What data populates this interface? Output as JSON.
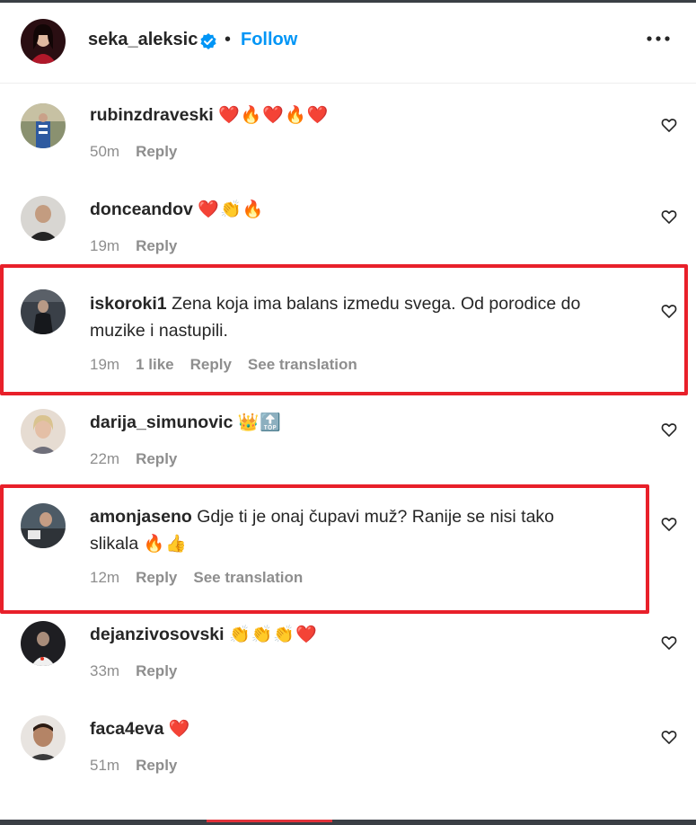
{
  "post": {
    "username": "seka_aleksic",
    "separator": "•",
    "follow_label": "Follow",
    "more_icon": "more-horizontal-icon",
    "verified_icon": "verified-badge-icon"
  },
  "comments": [
    {
      "username": "rubinzdraveski",
      "text": "",
      "emoji": "❤️🔥❤️🔥❤️",
      "time": "50m",
      "likes": "",
      "reply": "Reply",
      "translate": ""
    },
    {
      "username": "donceandov",
      "text": "",
      "emoji": "❤️👏🔥",
      "time": "19m",
      "likes": "",
      "reply": "Reply",
      "translate": ""
    },
    {
      "username": "iskoroki1",
      "text_line1": "Zena koja ima balans izmedu svega. Od porodice do",
      "text_line2": "muzike i nastupili.",
      "time": "19m",
      "likes": "1 like",
      "reply": "Reply",
      "translate": "See translation"
    },
    {
      "username": "darija_simunovic",
      "text": "",
      "emoji": "👑🔝",
      "time": "22m",
      "likes": "",
      "reply": "Reply",
      "translate": ""
    },
    {
      "username": "amonjaseno",
      "text_line1": "Gdje ti je onaj čupavi muž? Ranije se nisi tako",
      "text_line2": "slikala",
      "emoji": "🔥👍",
      "time": "12m",
      "likes": "",
      "reply": "Reply",
      "translate": "See translation"
    },
    {
      "username": "dejanzivosovski",
      "text": "",
      "emoji": "👏👏👏❤️",
      "time": "33m",
      "likes": "",
      "reply": "Reply",
      "translate": ""
    },
    {
      "username": "faca4eva",
      "text": "",
      "emoji": "❤️",
      "time": "51m",
      "likes": "",
      "reply": "Reply",
      "translate": ""
    }
  ],
  "colors": {
    "accent": "#0095f6",
    "highlight": "#e8202a",
    "muted": "#8e8e8e",
    "text": "#262626"
  }
}
